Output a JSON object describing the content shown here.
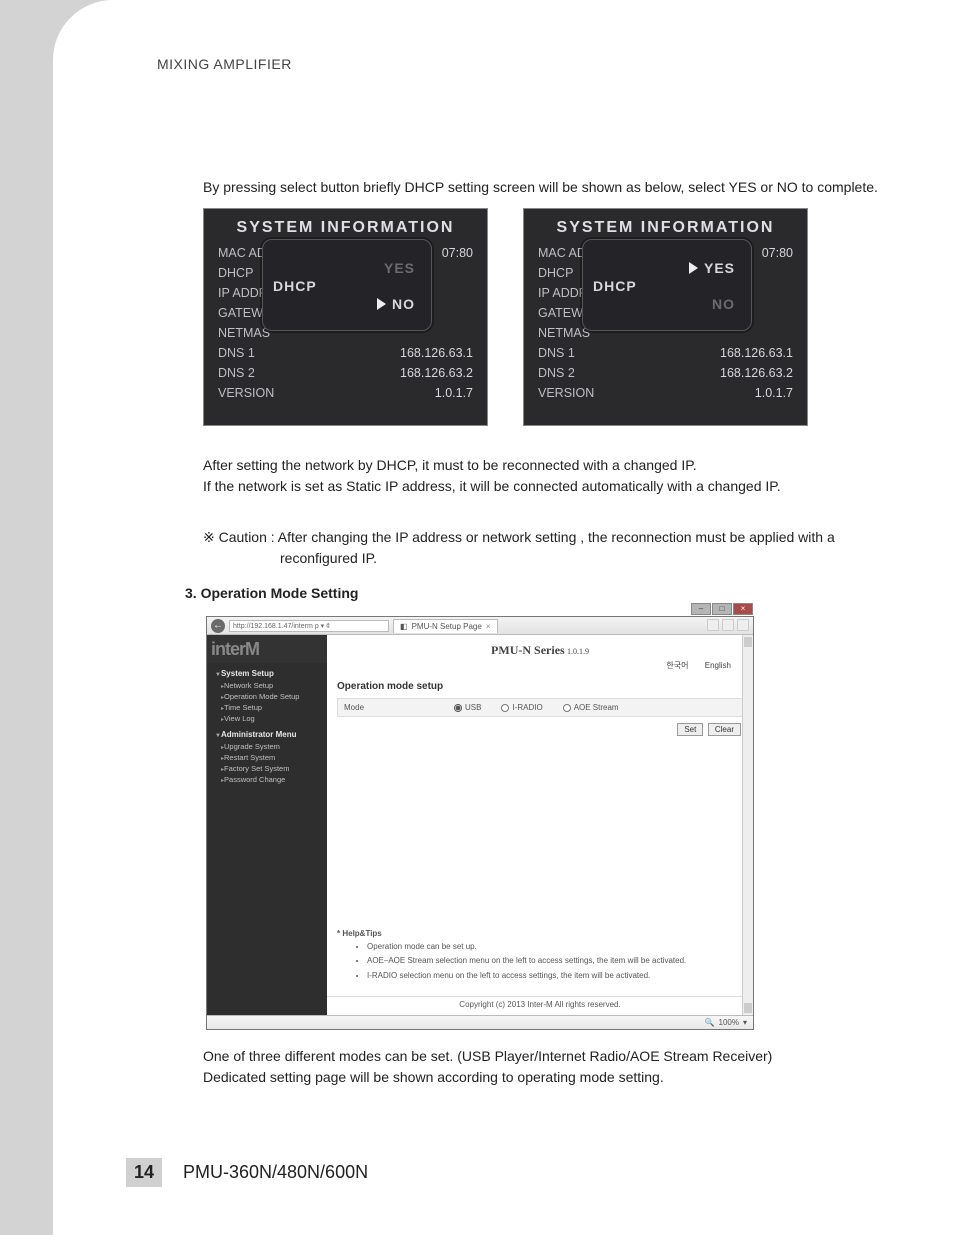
{
  "header": "MIXING AMPLIFIER",
  "intro": "By pressing select button briefly DHCP setting screen will be shown as below, select  YES or NO to complete.",
  "lcd": {
    "title": "SYSTEM INFORMATION",
    "rows": {
      "mac": {
        "k": "MAC ADD",
        "v": "07:80"
      },
      "dhcp": {
        "k": "DHCP",
        "v": ""
      },
      "ip": {
        "k": "IP ADDRE",
        "v": ""
      },
      "gateway": {
        "k": "GATEWA",
        "v": ""
      },
      "netmask": {
        "k": "NETMAS",
        "v": ""
      },
      "dns1": {
        "k": "DNS 1",
        "v": "168.126.63.1"
      },
      "dns2": {
        "k": "DNS 2",
        "v": "168.126.63.2"
      },
      "version": {
        "k": "VERSION",
        "v": "1.0.1.7"
      }
    },
    "popup": {
      "title": "DHCP",
      "yes": "YES",
      "no": "NO"
    }
  },
  "after": {
    "line1": "After setting the network by DHCP, it must to be reconnected with a changed IP.",
    "line2": "If the network is set as Static IP address, it will be connected automatically with a changed IP."
  },
  "caution": {
    "prefix": "※ Caution :",
    "text": "After changing the IP address or network setting , the reconnection must be applied with a",
    "text2": "reconfigured IP."
  },
  "section_heading": "3. Operation Mode Setting",
  "browser": {
    "url": "http://192.168.1.47/interm  ρ ▾ ¢",
    "tab_title": "PMU-N Setup Page",
    "brand": "interM",
    "series": "PMU-N Series",
    "version": "1.0.1.9",
    "lang_ko": "한국어",
    "lang_en": "English",
    "sidebar": {
      "group1": "System Setup",
      "g1_items": [
        "Network Setup",
        "Operation Mode Setup",
        "Time Setup",
        "View Log"
      ],
      "group2": "Administrator Menu",
      "g2_items": [
        "Upgrade System",
        "Restart System",
        "Factory Set System",
        "Password Change"
      ]
    },
    "content_title": "Operation mode setup",
    "mode_label": "Mode",
    "modes": {
      "usb": "USB",
      "iradio": "I-RADIO",
      "aoe": "AOE Stream"
    },
    "btn_set": "Set",
    "btn_clear": "Clear",
    "tips_header": "* Help&Tips",
    "tips": [
      "Operation mode can be set up.",
      "AOE–AOE Stream selection menu on the left to access settings, the item will be activated.",
      "I-RADIO selection menu on the left to access settings, the item will be activated."
    ],
    "copyright": "Copyright (c) 2013 Inter-M All rights reserved.",
    "zoom": "100%"
  },
  "outro": {
    "line1": "One of three different modes can be set. (USB Player/Internet Radio/AOE Stream Receiver)",
    "line2": "Dedicated setting page will be shown according to operating mode setting."
  },
  "footer": {
    "pageno": "14",
    "model": "PMU-360N/480N/600N"
  }
}
